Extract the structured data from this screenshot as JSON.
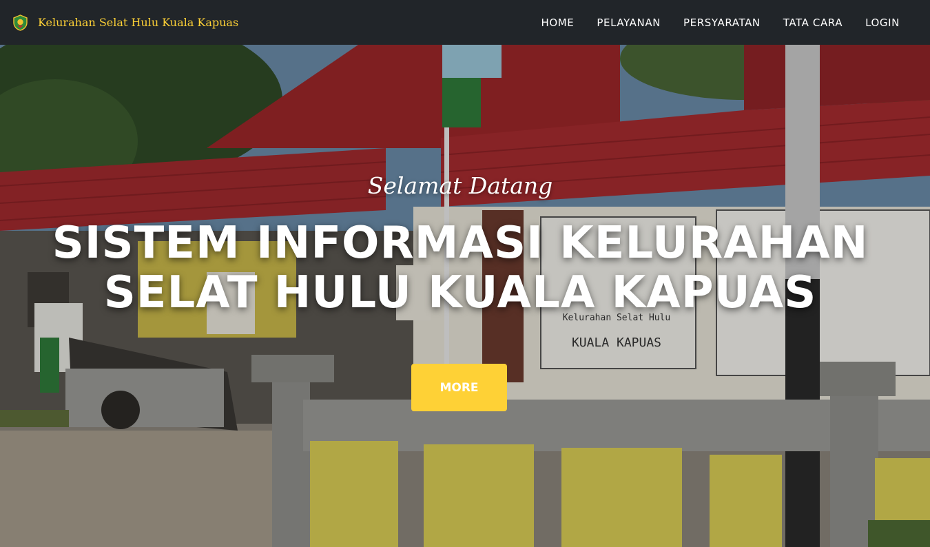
{
  "navbar": {
    "brand_text": "Kelurahan Selat Hulu Kuala Kapuas",
    "logo_icon": "kelurahan-emblem-icon",
    "items": [
      {
        "label": "HOME"
      },
      {
        "label": "PELAYANAN"
      },
      {
        "label": "PERSYARATAN"
      },
      {
        "label": "TATA CARA"
      },
      {
        "label": "LOGIN"
      }
    ]
  },
  "hero": {
    "subtitle": "Selamat Datang",
    "title_lines": [
      "SISTEM INFORMASI KELURAHAN",
      "SELAT HULU KUALA KAPUAS"
    ],
    "button_label": "MORE",
    "sign_line_1": "Kelurahan Selat Hulu",
    "sign_line_2": "KUALA KAPUAS"
  },
  "colors": {
    "navbar_bg": "#212529",
    "brand_text": "#fed136",
    "accent_button": "#fed136",
    "roof_red": "#a02a2e",
    "wall_yellow": "#d8cc55"
  }
}
